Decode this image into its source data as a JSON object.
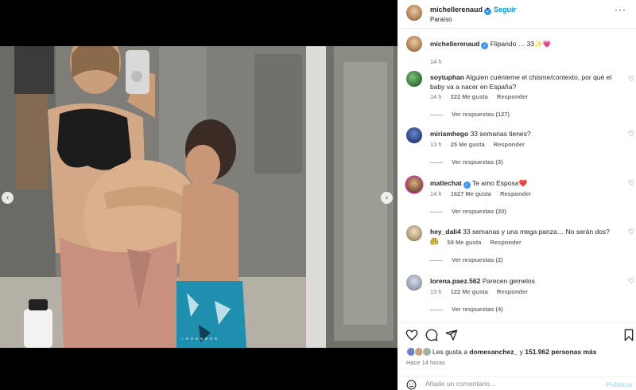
{
  "post": {
    "username": "michellerenaud",
    "follow_label": "Seguir",
    "separator": "•",
    "location": "Paraíso",
    "caption": "Flipando … 33✨💗",
    "caption_time": "14 h",
    "carousel": {
      "current": 1,
      "total": 8
    }
  },
  "comments": [
    {
      "user": "soytuphan",
      "verified": false,
      "text": "Alguien cuénteme el chisme/contexto, por qué el baby va a nacer en España?",
      "time": "14 h",
      "likes": "222 Me gusta",
      "reply": "Responder",
      "view_replies": "Ver respuestas (127)"
    },
    {
      "user": "miriamhego",
      "verified": false,
      "text": "33 semanas tienes?",
      "time": "13 h",
      "likes": "25 Me gusta",
      "reply": "Responder",
      "view_replies": "Ver respuestas (3)"
    },
    {
      "user": "matlechat",
      "verified": true,
      "text": "Te amo Esposa❤️",
      "time": "14 h",
      "likes": "1627 Me gusta",
      "reply": "Responder",
      "view_replies": "Ver respuestas (20)"
    },
    {
      "user": "hey_dali4",
      "verified": false,
      "text": "33 semanas y una mega panza… No serán dos? 🤔",
      "time": "8 h",
      "likes": "59 Me gusta",
      "reply": "Responder",
      "view_replies": "Ver respuestas (2)"
    },
    {
      "user": "lorena.paez.562",
      "verified": false,
      "text": "Parecen gemelos",
      "time": "13 h",
      "likes": "122 Me gusta",
      "reply": "Responder",
      "view_replies": "Ver respuestas (4)"
    }
  ],
  "likes_summary": {
    "prefix": "Les gusta a ",
    "user": "domesanchez_",
    "middle": " y ",
    "count": "151.962 personas más"
  },
  "posted_ago": "Hace 14 horas",
  "add_comment": {
    "placeholder": "Añade un comentario…",
    "publish_label": "Publicar"
  },
  "icons": {
    "like": "heart-icon",
    "comment": "comment-icon",
    "share": "share-icon",
    "save": "bookmark-icon",
    "emoji": "emoji-icon",
    "more": "more-options-icon",
    "prev": "chevron-left-icon",
    "next": "chevron-right-icon",
    "verified": "verified-badge-icon"
  },
  "colors": {
    "link": "#0095f6",
    "verified": "#3897f0",
    "muted": "#737373",
    "text": "#262626"
  }
}
